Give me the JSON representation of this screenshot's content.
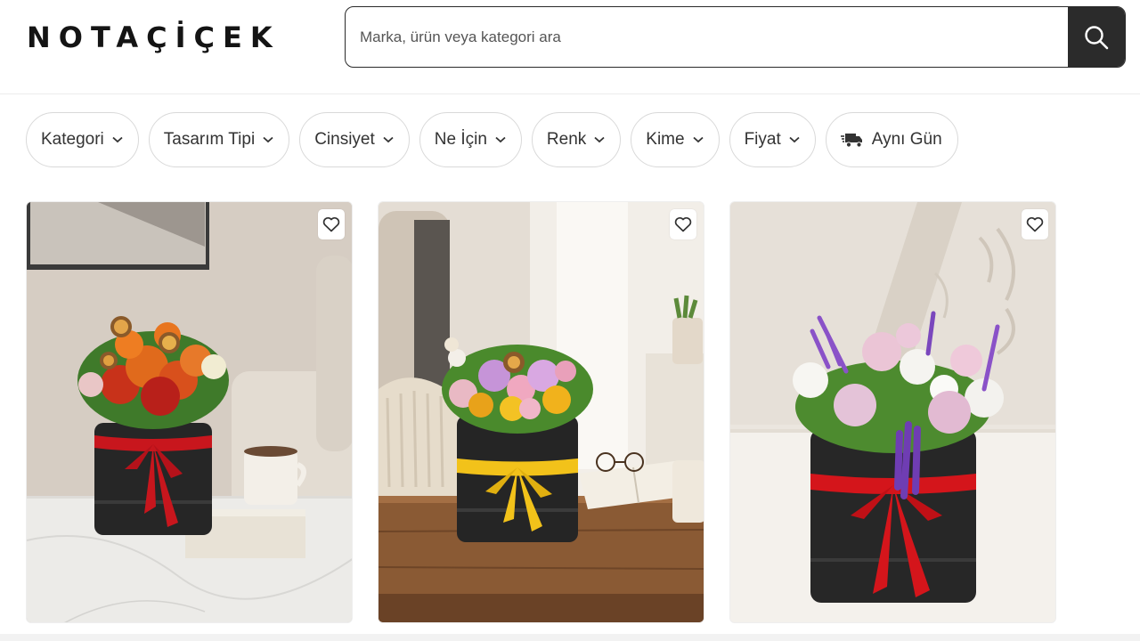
{
  "header": {
    "logo": "NOTAÇİÇEK",
    "search_placeholder": "Marka, ürün veya kategori ara"
  },
  "filters": [
    {
      "label": "Kategori"
    },
    {
      "label": "Tasarım Tipi"
    },
    {
      "label": "Cinsiyet"
    },
    {
      "label": "Ne İçin"
    },
    {
      "label": "Renk"
    },
    {
      "label": "Kime"
    },
    {
      "label": "Fiyat"
    },
    {
      "label": "Aynı Gün"
    }
  ],
  "products": [
    {
      "ribbon_color": "#c8161d",
      "flowers": "orange roses, dried orange slices"
    },
    {
      "ribbon_color": "#f2c21a",
      "flowers": "mixed pink, purple and yellow flowers"
    },
    {
      "ribbon_color": "#d4151b",
      "flowers": "pink roses, white chrysanthemums, lavender"
    }
  ],
  "colors": {
    "accent": "#2b2b2b",
    "border": "#d9d9d9"
  }
}
